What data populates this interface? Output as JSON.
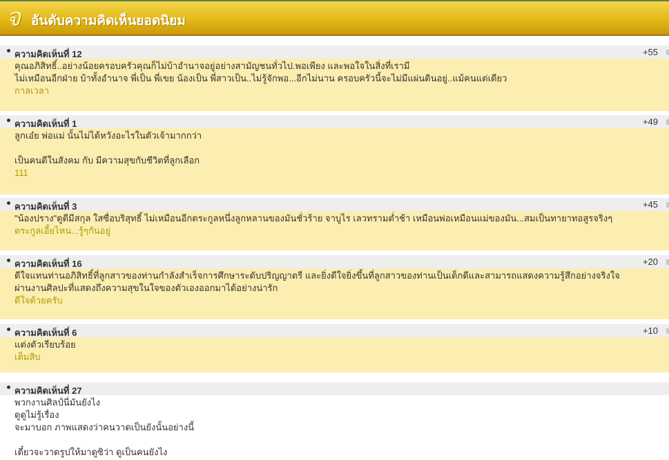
{
  "header": {
    "logo_char": "จ",
    "title": "อันดับความคิดเห็นยอดนิยม"
  },
  "comments": [
    {
      "label": "ความคิดเห็นที่ 12",
      "score": "+55",
      "lines": [
        "คุณอภิสิทธิ์..อย่างน้อยครอบครัวคุณก็ไม่บ้าอำนาจอยู่อย่างสามัญชนทั่วไป.พอเพียง และพอใจในสิ่งที่เรามี",
        "ไม่เหมือนอีกฝ่าย บ้าทั้งอำนาจ พี่เป็น พี่เขย น้องเป็น พี่สาวเป็น..ไม่รู้จักพอ...อีกไม่นาน ครอบครัวนี้จะไม่มีแผ่นดินอยู่..แม้คนแต่เดียว"
      ],
      "signature": "กาลเวลา"
    },
    {
      "label": "ความคิดเห็นที่ 1",
      "score": "+49",
      "lines": [
        "ลูกเอ๋ย พ่อแม่ นั้นไม่ได้หวังอะไรในตัวเจ้ามากกว่า",
        "",
        "เป็นคนดีในสังคม กับ มีความสุขกับชีวิตที่ลูกเลือก"
      ],
      "signature": "111"
    },
    {
      "label": "ความคิดเห็นที่ 3",
      "score": "+45",
      "lines": [
        "\"น้องปราง\"ดูดีมีสกุล ใสซื่อบริสุทธิ์ ไม่เหมือนอีกตระกูลหนึ่งลูกหลานของมันชั่วร้าย จาบูไร เลวทรามต่ำช้า เหมือนพ่อเหมือนแม่ของมัน...สมเป็นทายาทอสูรจริงๆ"
      ],
      "signature": "ตระกูลเอี้ยไหน...รู้ๆกันอยู่"
    },
    {
      "label": "ความคิดเห็นที่ 16",
      "score": "+20",
      "lines": [
        "ดีใจแทนท่านอภิสิทธิ์ที่ลูกสาวของท่านกำลังสำเร็จการศึกษาระดับปริญญาตรี และยิ่งดีใจยิ่งขึ้นที่ลูกสาวของท่านเป็นเด็กดีและสามารถแสดงความรู้สึกอย่างจริงใจ",
        "ผ่านงานศิลปะที่แสดงถึงความสุขในใจของตัวเองออกมาได้อย่างน่ารัก"
      ],
      "signature": "ดีใจด้วยครับ"
    },
    {
      "label": "ความคิดเห็นที่ 6",
      "score": "+10",
      "lines": [
        "แต่งตัวเรียบร้อย"
      ],
      "signature": "เต็มสิบ"
    },
    {
      "label": "ความคิดเห็นที่ 27",
      "score": "",
      "lines": [
        "พวกงานศิลป์นี่มันยังไง",
        "ดูดูไม่รู้เรื่อง",
        "จะมาบอก ภาพแสดงว่าคนวาดเป็นยังนั้นอย่างนี้",
        "",
        "เดี๋ยวจะวาดรูปให้มาดูซิว่า ดูเป็นคนยังไง"
      ],
      "signature": ""
    }
  ]
}
